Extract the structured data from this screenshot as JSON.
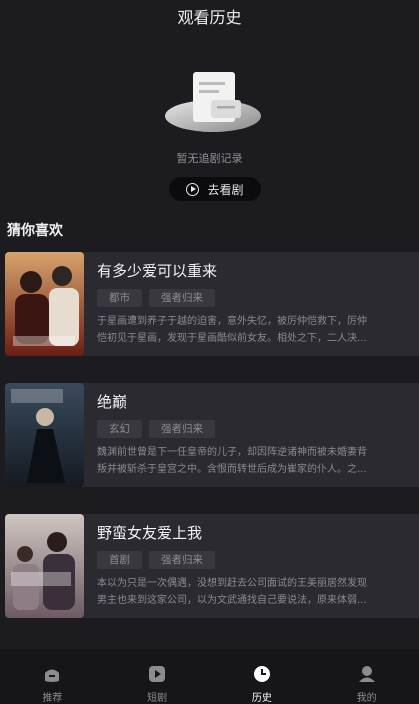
{
  "header": {
    "title": "观看历史"
  },
  "empty": {
    "text": "暂无追剧记录",
    "button_label": "去看剧"
  },
  "section": {
    "title": "猜你喜欢"
  },
  "cards": [
    {
      "title": "有多少爱可以重来",
      "tags": [
        "都市",
        "强者归来"
      ],
      "desc_line1": "于星画遭到养子于越的迫害，意外失忆，被厉仲恺救下，厉仲",
      "desc_line2": "恺初见于星画，发现于星画酷似前女友。相处之下，二人决..."
    },
    {
      "title": "绝巅",
      "tags": [
        "玄幻",
        "强者归来"
      ],
      "desc_line1": "魏渊前世曾是下一任皇帝的儿子，却因阵逆诸神而被未婚妻背",
      "desc_line2": "叛并被斩杀于皇宫之中。含恨而转世后成为崔家的仆人。之..."
    },
    {
      "title": "野蛮女友爱上我",
      "tags": [
        "首剧",
        "强者归来"
      ],
      "desc_line1": "本以为只是一次偶遇，没想到赶去公司面试的王美丽居然发现",
      "desc_line2": "男主也来到这家公司，以为文武通找自己要说法，原来体弱..."
    }
  ],
  "tabbar": {
    "items": [
      {
        "label": "推荐",
        "icon": "home-icon"
      },
      {
        "label": "短剧",
        "icon": "play-icon"
      },
      {
        "label": "历史",
        "icon": "clock-icon",
        "active": true
      },
      {
        "label": "我的",
        "icon": "person-icon"
      }
    ]
  },
  "colors": {
    "background": "#1c1c20",
    "card": "#2a2a30",
    "tabbar": "#16161a"
  }
}
